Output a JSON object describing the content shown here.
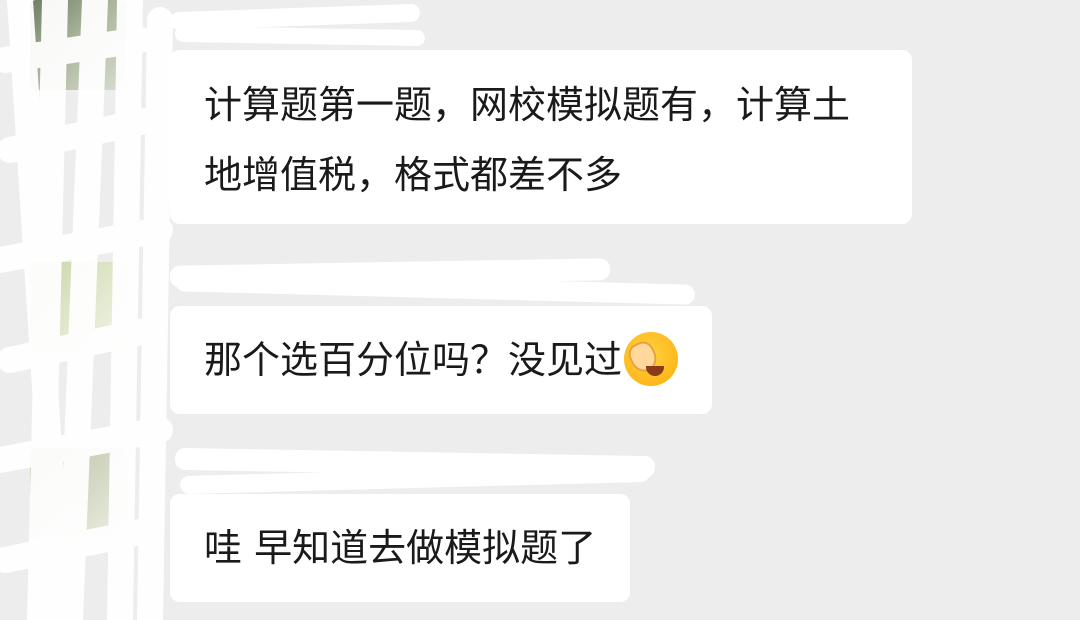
{
  "messages": [
    {
      "text": "计算题第一题，网校模拟题有，计算土地增值税，格式都差不多"
    },
    {
      "text": "那个选百分位吗？没见过",
      "emoji": "face-palm-icon"
    },
    {
      "text": "哇 早知道去做模拟题了"
    }
  ],
  "colors": {
    "background": "#ededed",
    "bubble": "#ffffff",
    "text": "#1a1a1a",
    "redaction": "#ffffff"
  }
}
